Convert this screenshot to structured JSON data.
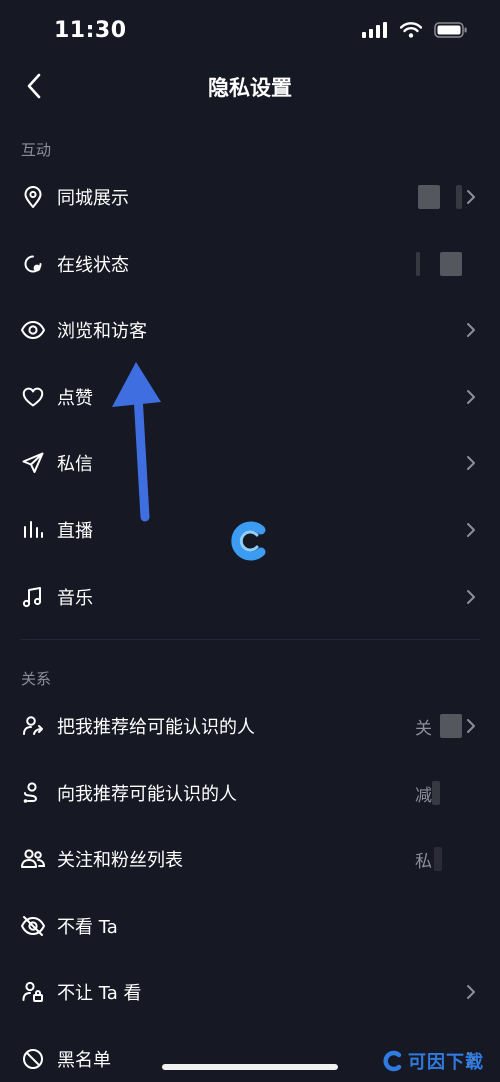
{
  "status_bar": {
    "time": "11:30"
  },
  "nav": {
    "title": "隐私设置"
  },
  "sections": {
    "interaction": {
      "header": "互动",
      "items": [
        {
          "label": "同城展示",
          "icon": "location-pin-icon",
          "value": "",
          "blurred_value": true,
          "has_chevron": true
        },
        {
          "label": "在线状态",
          "icon": "online-status-icon",
          "value": "",
          "blurred_value": true,
          "has_chevron": false
        },
        {
          "label": "浏览和访客",
          "icon": "eye-icon",
          "value": "",
          "blurred_value": false,
          "has_chevron": true
        },
        {
          "label": "点赞",
          "icon": "heart-icon",
          "value": "",
          "blurred_value": false,
          "has_chevron": true
        },
        {
          "label": "私信",
          "icon": "send-icon",
          "value": "",
          "blurred_value": false,
          "has_chevron": true
        },
        {
          "label": "直播",
          "icon": "live-bars-icon",
          "value": "",
          "blurred_value": false,
          "has_chevron": true
        },
        {
          "label": "音乐",
          "icon": "music-note-icon",
          "value": "",
          "blurred_value": false,
          "has_chevron": true
        }
      ]
    },
    "relationship": {
      "header": "关系",
      "items": [
        {
          "label": "把我推荐给可能认识的人",
          "icon": "user-share-icon",
          "value": "关",
          "blurred_value": true,
          "has_chevron": true
        },
        {
          "label": "向我推荐可能认识的人",
          "icon": "user-route-icon",
          "value": "减",
          "blurred_value": true,
          "has_chevron": false
        },
        {
          "label": "关注和粉丝列表",
          "icon": "users-icon",
          "value": "私",
          "blurred_value": true,
          "has_chevron": false
        },
        {
          "label": "不看 Ta",
          "icon": "eye-off-icon",
          "value": "",
          "blurred_value": false,
          "has_chevron": false
        },
        {
          "label": "不让 Ta 看",
          "icon": "user-lock-icon",
          "value": "",
          "blurred_value": false,
          "has_chevron": true
        },
        {
          "label": "黑名单",
          "icon": "block-icon",
          "value": "",
          "blurred_value": false,
          "has_chevron": true
        }
      ]
    }
  },
  "watermark": {
    "corner_text": "可因下载"
  },
  "colors": {
    "background": "#161824",
    "text": "#ffffff",
    "muted": "#8c8f9a",
    "annotation_arrow": "#3f6ee0",
    "logo_blue": "#2f7be0"
  }
}
